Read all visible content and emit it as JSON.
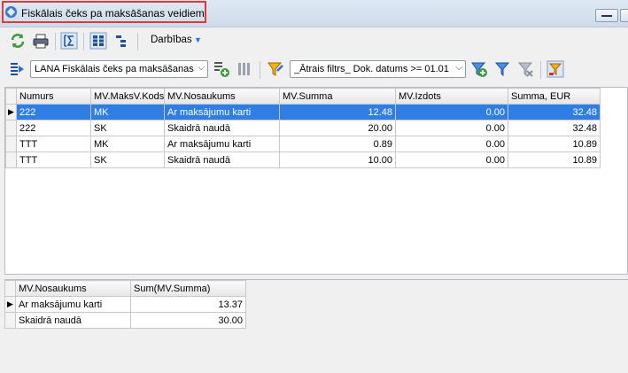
{
  "window": {
    "title": "Fiskālais čeks pa maksāšanas veidiem"
  },
  "toolbar1": {
    "actions_label": "Darbības"
  },
  "toolbar2": {
    "report_combo_value": "LANA Fiskālais čeks pa maksāšanas v",
    "filter_combo_value": "_Ātrais filtrs_ Dok. datums >= 01.01"
  },
  "main_grid": {
    "columns": [
      "Numurs",
      "MV.MaksV.Kods",
      "MV.Nosaukums",
      "MV.Summa",
      "MV.Izdots",
      "Summa, EUR"
    ],
    "rows": [
      {
        "numurs": "222",
        "kods": "MK",
        "nosaukums": "Ar maksājumu karti",
        "summa": "12.48",
        "izdots": "0.00",
        "summa_eur": "32.48"
      },
      {
        "numurs": "222",
        "kods": "SK",
        "nosaukums": "Skaidrā naudā",
        "summa": "20.00",
        "izdots": "0.00",
        "summa_eur": "32.48"
      },
      {
        "numurs": "TTT",
        "kods": "MK",
        "nosaukums": "Ar maksājumu karti",
        "summa": "0.89",
        "izdots": "0.00",
        "summa_eur": "10.89"
      },
      {
        "numurs": "TTT",
        "kods": "SK",
        "nosaukums": "Skaidrā naudā",
        "summa": "10.00",
        "izdots": "0.00",
        "summa_eur": "10.89"
      }
    ]
  },
  "summary_grid": {
    "columns": [
      "MV.Nosaukums",
      "Sum(MV.Summa)"
    ],
    "rows": [
      {
        "nosaukums": "Ar maksājumu karti",
        "sum": "13.37"
      },
      {
        "nosaukums": "Skaidrā naudā",
        "sum": "30.00"
      }
    ]
  },
  "colors": {
    "selection": "#2f7ee6",
    "title_highlight": "#e03a3a"
  }
}
